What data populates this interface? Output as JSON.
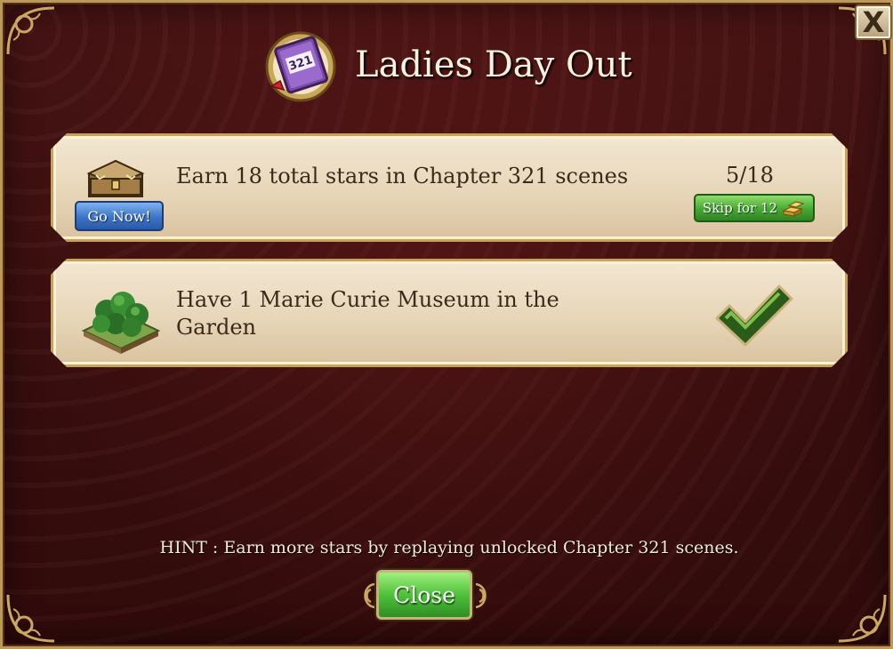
{
  "dialog": {
    "title": "Ladies Day Out",
    "close_x_label": "X",
    "book_badge": "321"
  },
  "tasks": [
    {
      "text": "Earn 18 total stars in Chapter 321 scenes",
      "icon": "treasure-chest-icon",
      "action_label": "Go Now!",
      "progress": "5/18",
      "skip_label": "Skip for 12",
      "skip_icon": "gold-bars-icon"
    },
    {
      "text": "Have 1 Marie Curie Museum in the Garden",
      "icon": "garden-trees-icon",
      "status": "complete",
      "status_icon": "checkmark-icon"
    }
  ],
  "hint": "HINT : Earn more stars by replaying unlocked Chapter 321 scenes.",
  "close_label": "Close",
  "colors": {
    "background": "#3a0d0d",
    "card": "#ecdcc2",
    "go_button": "#3c74c7",
    "skip_button": "#45a833",
    "close_button": "#4ec23b",
    "text_dark": "#3b2a1c"
  }
}
